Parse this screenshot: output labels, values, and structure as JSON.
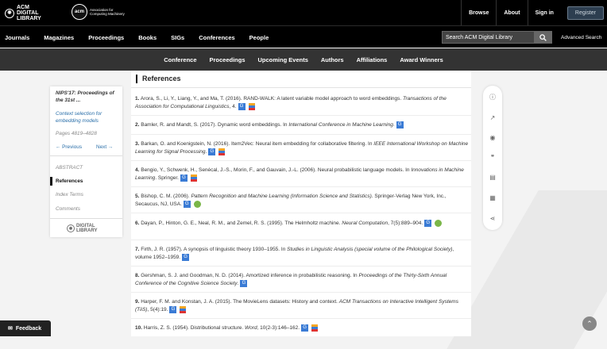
{
  "header": {
    "logo_text_1": "ACM",
    "logo_text_2": "DIGITAL",
    "logo_text_3": "LIBRARY",
    "assoc_line1": "Association for",
    "assoc_line2": "Computing Machinery",
    "links": [
      "Browse",
      "About",
      "Sign in"
    ],
    "register": "Register"
  },
  "nav": {
    "items": [
      "Journals",
      "Magazines",
      "Proceedings",
      "Books",
      "SIGs",
      "Conferences",
      "People"
    ],
    "search_placeholder": "Search ACM Digital Library",
    "advanced": "Advanced Search"
  },
  "subnav": {
    "items": [
      "Conference",
      "Proceedings",
      "Upcoming Events",
      "Authors",
      "Affiliations",
      "Award Winners"
    ]
  },
  "leftcard": {
    "title": "NIPS'17: Proceedings of the 31st ...",
    "article": "Context selection for embedding models",
    "pages": "Pages 4819–4828",
    "prev": "← Previous",
    "next": "Next →",
    "abstract": "ABSTRACT",
    "references": "References",
    "index_terms": "Index Terms",
    "comments": "Comments",
    "dl_logo_1": "DIGITAL",
    "dl_logo_2": "LIBRARY"
  },
  "main": {
    "heading": "References",
    "refs": [
      {
        "n": "1.",
        "text": "Arora, S., Li, Y., Liang, Y., and Ma, T. (2016). RAND-WALK: A latent variable model approach to word embeddings.",
        "venue": "Transactions of the Association for Computational Linguistics",
        "tail": ", 4."
      },
      {
        "n": "2.",
        "text": "Bamler, R. and Mandt, S. (2017). Dynamic word embeddings. In",
        "venue": "International Conference in Machine Learning",
        "tail": "."
      },
      {
        "n": "3.",
        "text": "Barkan, O. and Koenigstein, N. (2016). Item2Vec: Neural item embedding for collaborative filtering. In",
        "venue": "IEEE International Workshop on Machine Learning for Signal Processing",
        "tail": "."
      },
      {
        "n": "4.",
        "text": "Bengio, Y., Schwenk, H., Senécal, J.-S., Morin, F., and Gauvain, J.-L. (2006). Neural probabilistic language models. In",
        "venue": "Innovations in Machine Learning",
        "tail": ". Springer."
      },
      {
        "n": "5.",
        "text": "Bishop, C. M. (2006).",
        "venue": "Pattern Recognition and Machine Learning (Information Science and Statistics)",
        "tail": ". Springer-Verlag New York, Inc., Secaucus, NJ, USA."
      },
      {
        "n": "6.",
        "text": "Dayan, P., Hinton, G. E., Neal, R. M., and Zemel, R. S. (1995). The Helmholtz machine.",
        "venue": "Neural Computation",
        "tail": ", 7(5):889–904."
      },
      {
        "n": "7.",
        "text": "Firth, J. R. (1957). A synopsis of linguistic theory 1930–1955. In",
        "venue": "Studies in Linguistic Analysis (special volume of the Philological Society)",
        "tail": ", volume 1952–1959."
      },
      {
        "n": "8.",
        "text": "Gershman, S. J. and Goodman, N. D. (2014). Amortized inference in probabilistic reasoning. In",
        "venue": "Proceedings of the Thirty-Sixth Annual Conference of the Cognitive Science Society",
        "tail": "."
      },
      {
        "n": "9.",
        "text": "Harper, F. M. and Konstan, J. A. (2015). The MovieLens datasets: History and context.",
        "venue": "ACM Transactions on Interactive Intelligent Systems (TiiS)",
        "tail": ", 5(4):19."
      },
      {
        "n": "10.",
        "text": "Harris, Z. S. (1954). Distributional structure.",
        "venue": "Word",
        "tail": ", 10(2-3):146–162."
      }
    ]
  },
  "footer": {
    "feedback": "Feedback"
  }
}
